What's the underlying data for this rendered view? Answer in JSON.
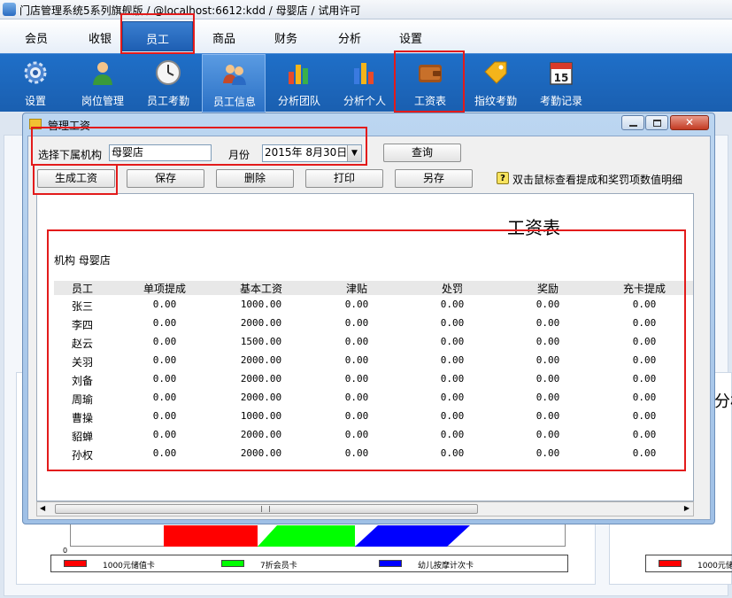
{
  "window": {
    "title": "门店管理系统5系列旗舰版 / @localhost:6612:kdd / 母婴店 / 试用许可"
  },
  "menu": [
    {
      "label": "会员"
    },
    {
      "label": "收银"
    },
    {
      "label": "员工"
    },
    {
      "label": "商品"
    },
    {
      "label": "财务"
    },
    {
      "label": "分析"
    },
    {
      "label": "设置"
    }
  ],
  "toolbar": [
    {
      "label": "设置",
      "icon": "gear-icon"
    },
    {
      "label": "岗位管理",
      "icon": "person-icon"
    },
    {
      "label": "员工考勤",
      "icon": "clock-icon"
    },
    {
      "label": "员工信息",
      "icon": "people-icon"
    },
    {
      "label": "分析团队",
      "icon": "bar-chart-icon"
    },
    {
      "label": "分析个人",
      "icon": "bar-chart-icon"
    },
    {
      "label": "工资表",
      "icon": "wallet-icon"
    },
    {
      "label": "指纹考勤",
      "icon": "tag-icon"
    },
    {
      "label": "考勤记录",
      "icon": "calendar-icon",
      "day": "15"
    }
  ],
  "dialog": {
    "title": "管理工资",
    "org_label": "选择下属机构",
    "org_value": "母婴店",
    "month_label": "月份",
    "month_value": "2015年  8月30日",
    "query_button": "查询",
    "buttons": {
      "generate": "生成工资",
      "save": "保存",
      "delete": "删除",
      "print": "打印",
      "save_as": "另存"
    },
    "help_text": "双击鼠标查看提成和奖罚项数值明细"
  },
  "report": {
    "title": "工资表",
    "org_line": "机构  母婴店",
    "columns": [
      "员工",
      "单项提成",
      "基本工资",
      "津贴",
      "处罚",
      "奖励",
      "充卡提成"
    ],
    "rows": [
      [
        "张三",
        "0.00",
        "1000.00",
        "0.00",
        "0.00",
        "0.00",
        "0.00"
      ],
      [
        "李四",
        "0.00",
        "2000.00",
        "0.00",
        "0.00",
        "0.00",
        "0.00"
      ],
      [
        "赵云",
        "0.00",
        "1500.00",
        "0.00",
        "0.00",
        "0.00",
        "0.00"
      ],
      [
        "关羽",
        "0.00",
        "2000.00",
        "0.00",
        "0.00",
        "0.00",
        "0.00"
      ],
      [
        "刘备",
        "0.00",
        "2000.00",
        "0.00",
        "0.00",
        "0.00",
        "0.00"
      ],
      [
        "周瑜",
        "0.00",
        "2000.00",
        "0.00",
        "0.00",
        "0.00",
        "0.00"
      ],
      [
        "曹操",
        "0.00",
        "1000.00",
        "0.00",
        "0.00",
        "0.00",
        "0.00"
      ],
      [
        "貂蝉",
        "0.00",
        "2000.00",
        "0.00",
        "0.00",
        "0.00",
        "0.00"
      ],
      [
        "孙权",
        "0.00",
        "2000.00",
        "0.00",
        "0.00",
        "0.00",
        "0.00"
      ]
    ]
  },
  "background": {
    "legend": [
      {
        "label": "1000元储值卡",
        "color": "#ff0000"
      },
      {
        "label": "7折会员卡",
        "color": "#00ff00"
      },
      {
        "label": "幼儿按摩计次卡",
        "color": "#0000ff"
      }
    ],
    "legend_right": "1000元储",
    "axis_zero": "0",
    "partial_title": "分析"
  },
  "colors": {
    "accent": "#1e5fb3",
    "highlight": "#e31b1b"
  }
}
